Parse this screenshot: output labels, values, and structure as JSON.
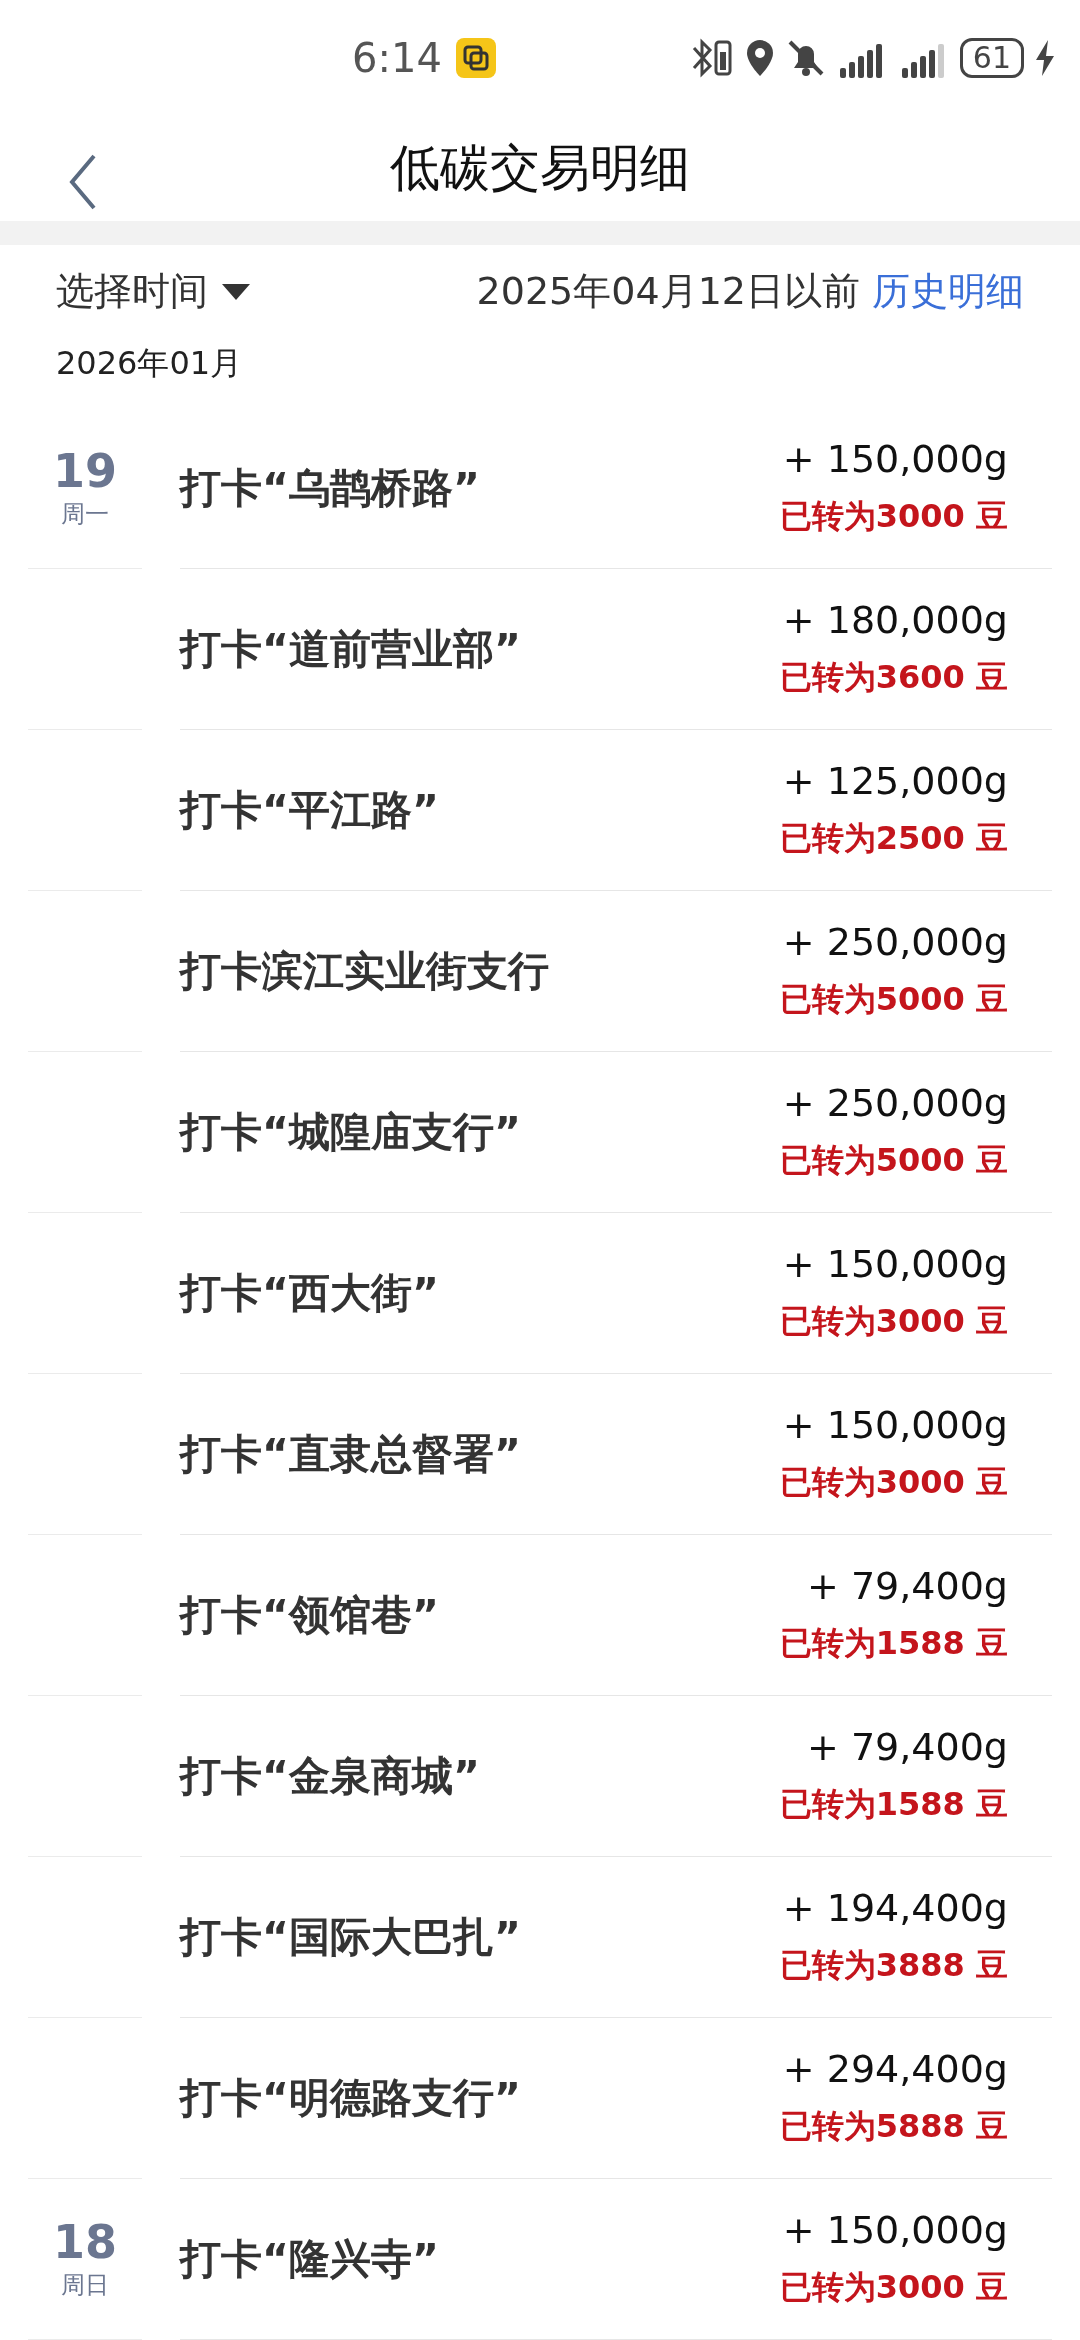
{
  "status_bar": {
    "time": "6:14",
    "battery": "61"
  },
  "header": {
    "title": "低碳交易明细"
  },
  "filter": {
    "label": "选择时间",
    "cutoff": "2025年04月12日以前",
    "link": "历史明细"
  },
  "month": "2026年01月",
  "days": [
    {
      "day": "19",
      "weekday": "周一",
      "items": [
        {
          "title": "打卡“乌鹊桥路”",
          "amount": "+ 150,000g",
          "converted": "已转为3000 豆"
        },
        {
          "title": "打卡“道前营业部”",
          "amount": "+ 180,000g",
          "converted": "已转为3600 豆"
        },
        {
          "title": "打卡“平江路”",
          "amount": "+ 125,000g",
          "converted": "已转为2500 豆"
        },
        {
          "title": "打卡滨江实业街支行",
          "amount": "+ 250,000g",
          "converted": "已转为5000 豆"
        },
        {
          "title": "打卡“城隍庙支行”",
          "amount": "+ 250,000g",
          "converted": "已转为5000 豆"
        },
        {
          "title": "打卡“西大街”",
          "amount": "+ 150,000g",
          "converted": "已转为3000 豆"
        },
        {
          "title": "打卡“直隶总督署”",
          "amount": "+ 150,000g",
          "converted": "已转为3000 豆"
        },
        {
          "title": "打卡“领馆巷”",
          "amount": "+ 79,400g",
          "converted": "已转为1588 豆"
        },
        {
          "title": "打卡“金泉商城”",
          "amount": "+ 79,400g",
          "converted": "已转为1588 豆"
        },
        {
          "title": "打卡“国际大巴扎”",
          "amount": "+ 194,400g",
          "converted": "已转为3888 豆"
        },
        {
          "title": "打卡“明德路支行”",
          "amount": "+ 294,400g",
          "converted": "已转为5888 豆"
        }
      ]
    },
    {
      "day": "18",
      "weekday": "周日",
      "items": [
        {
          "title": "打卡“隆兴寺”",
          "amount": "+ 150,000g",
          "converted": "已转为3000 豆"
        }
      ]
    }
  ]
}
